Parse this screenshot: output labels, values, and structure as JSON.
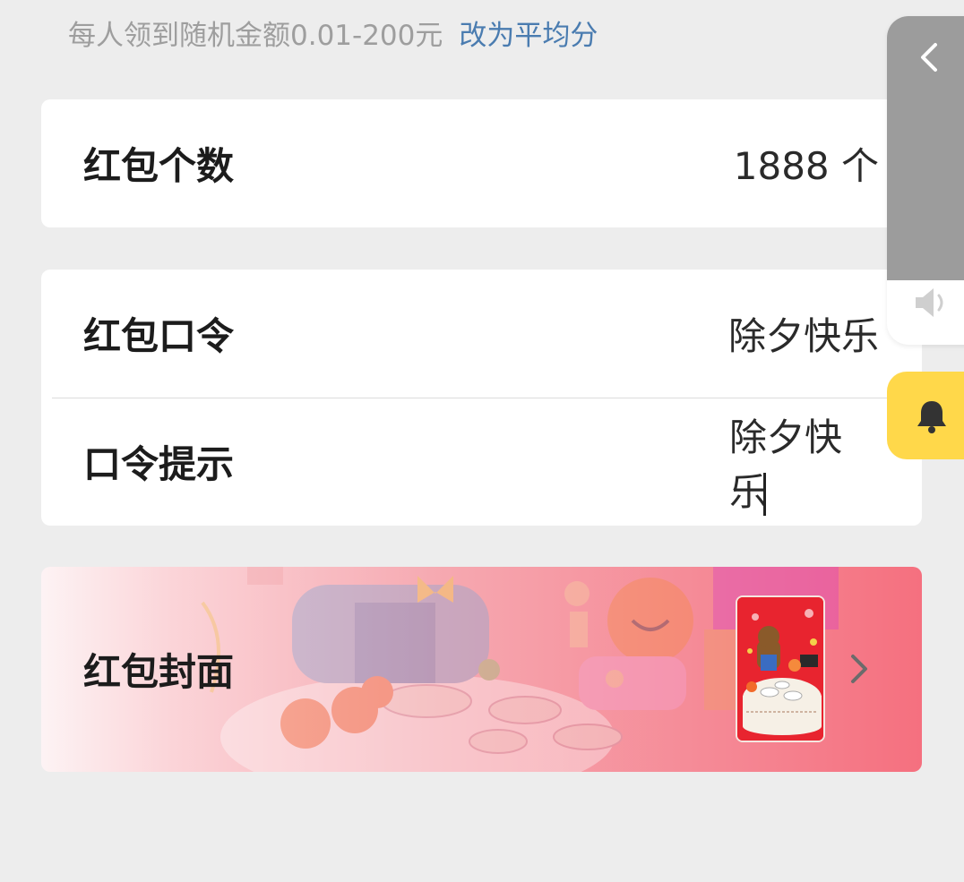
{
  "top_hint": {
    "text": "每人领到随机金额0.01-200元",
    "link_label": "改为平均分"
  },
  "packet_count": {
    "label": "红包个数",
    "value": "1888 个"
  },
  "password": {
    "label": "红包口令",
    "value": "除夕快乐"
  },
  "password_hint": {
    "label": "口令提示",
    "value": "除夕快乐"
  },
  "cover": {
    "label": "红包封面"
  },
  "side_panel": {
    "back_icon": "chevron-left-icon",
    "volume_icon": "speaker-icon",
    "bell_icon": "bell-icon"
  },
  "colors": {
    "background": "#ededed",
    "link": "#4a7cb0",
    "hint": "#9e9e9e",
    "bell_button": "#ffd84a",
    "cover_red": "#f5707f"
  }
}
